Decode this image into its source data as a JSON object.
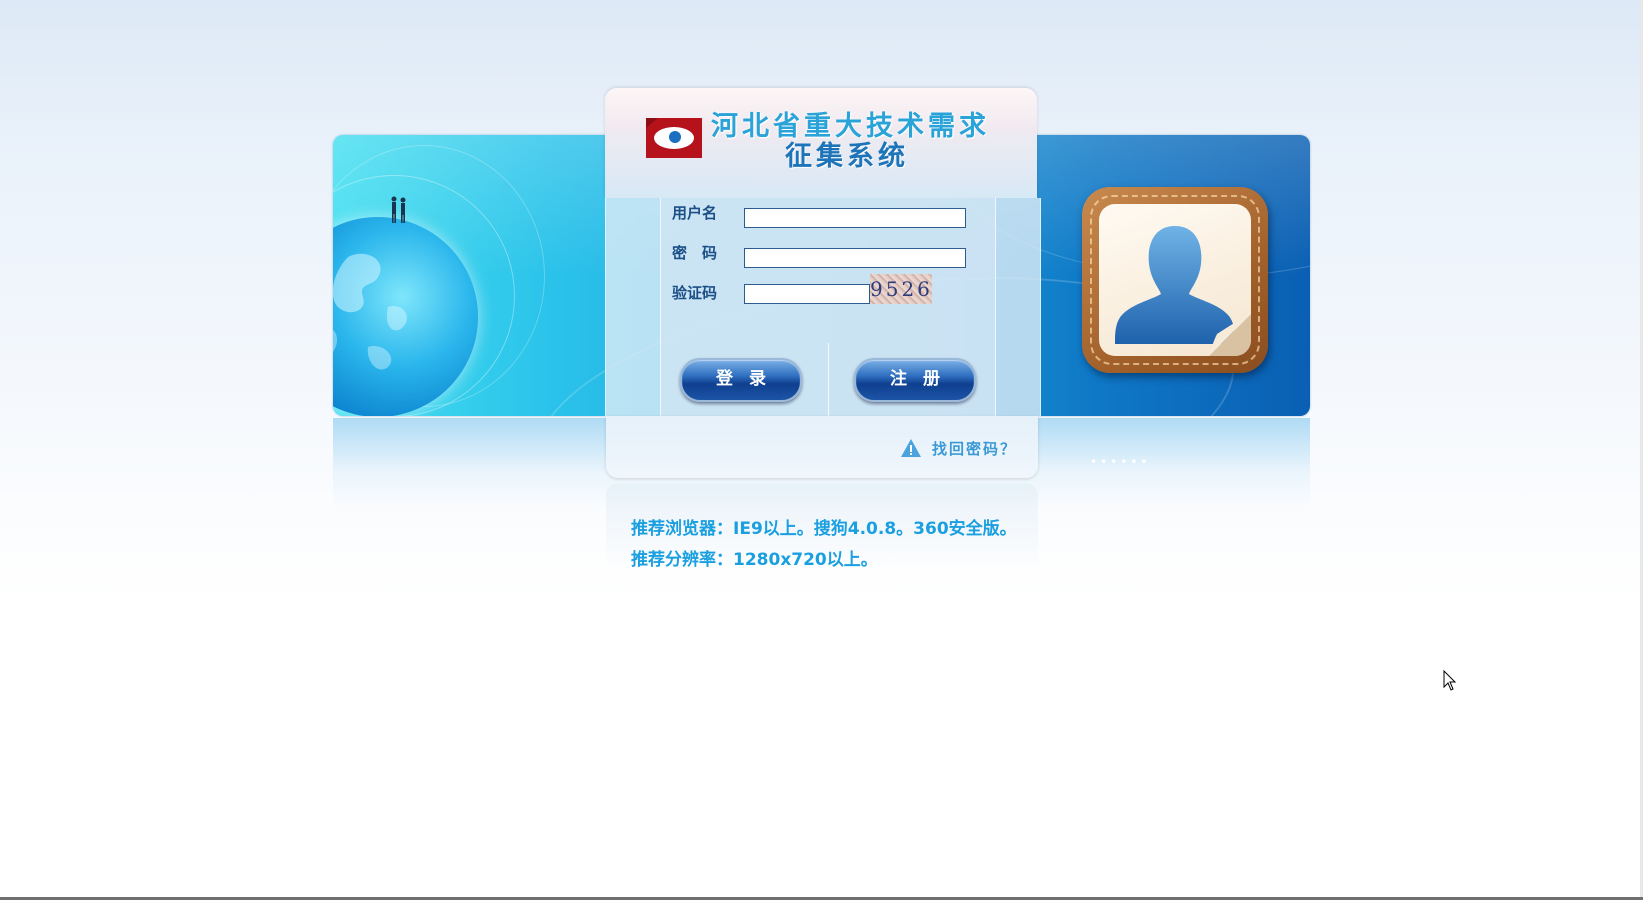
{
  "header": {
    "title_line1": "河北省重大技术需求",
    "title_line2": "征集系统"
  },
  "form": {
    "username_label": "用户名",
    "password_label": "密　码",
    "captcha_label": "验证码",
    "username_value": "",
    "password_value": "",
    "captcha_value": "",
    "captcha_image_text": "9526"
  },
  "buttons": {
    "login": "登录",
    "register": "注册"
  },
  "links": {
    "forgot_password": "找回密码？"
  },
  "recommendations": {
    "browser": "推荐浏览器：IE9以上。搜狗4.0.8。360安全版。",
    "resolution": "推荐分辨率：1280x720以上。"
  },
  "colors": {
    "title_primary": "#2aa3d8",
    "title_secondary": "#1e74b8",
    "recommend_text": "#1a9fe0",
    "button_dark": "#0f3f8f",
    "logo_red": "#b5121b"
  },
  "icons": {
    "logo": "eye-logo-icon",
    "warning": "warning-triangle-icon",
    "avatar": "user-silhouette-icon",
    "globe": "globe-icon"
  }
}
